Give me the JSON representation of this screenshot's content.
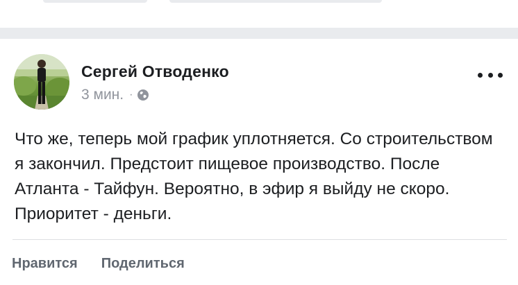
{
  "post": {
    "author": "Сергей Отводенко",
    "time": "3 мин.",
    "separator": "·",
    "audience_icon": "globe-icon",
    "more_icon": "more-options-icon",
    "text": "Что же, теперь мой график уплотняется. Со строительством я закончил. Предстоит пищевое производство. После Атланта - Тайфун. Вероятно, в эфир я выйду не скоро. Приоритет - деньги."
  },
  "actions": {
    "like_label": "Нравится",
    "share_label": "Поделиться"
  },
  "colors": {
    "text": "#1c1e21",
    "meta": "#90949c",
    "action": "#606770",
    "separator": "#e9ebee"
  }
}
